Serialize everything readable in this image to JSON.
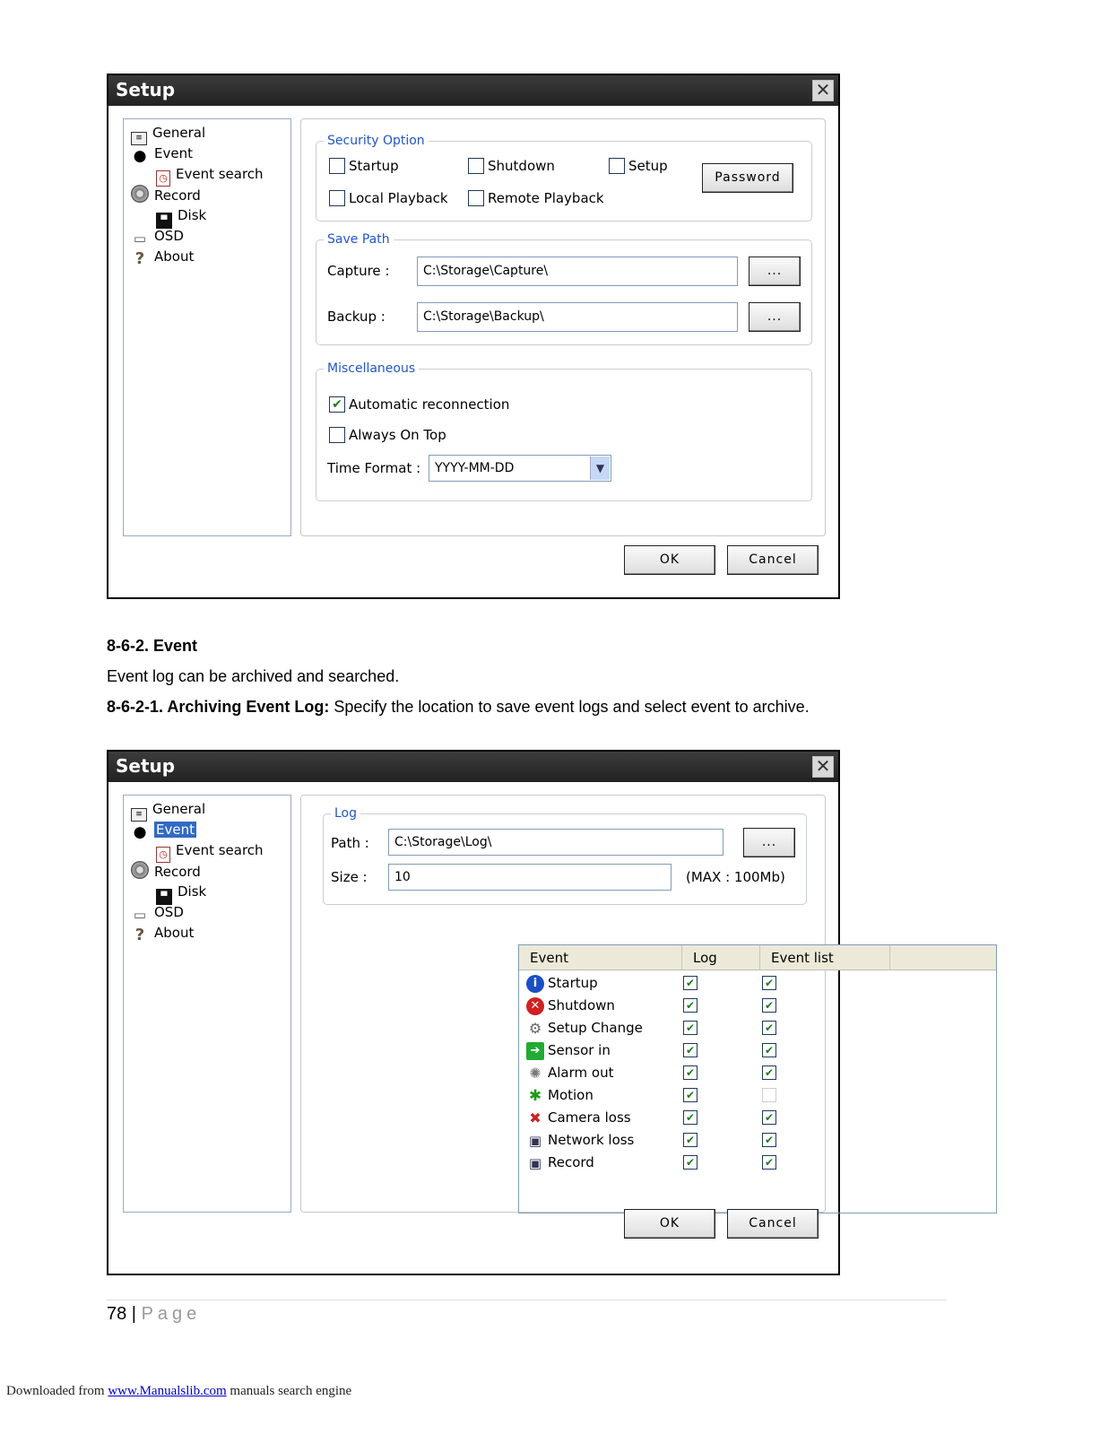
{
  "dialog1": {
    "title": "Setup",
    "close": "✕",
    "tree": [
      "General",
      "Event",
      "Event search",
      "Record",
      "Disk",
      "OSD",
      "About"
    ],
    "security": {
      "legend": "Security Option",
      "options": [
        "Startup",
        "Shutdown",
        "Setup",
        "Local Playback",
        "Remote Playback"
      ],
      "checked": [
        false,
        false,
        false,
        false,
        false
      ],
      "password_label": "Password"
    },
    "save_path": {
      "legend": "Save Path",
      "capture_label": "Capture :",
      "capture_value": "C:\\Storage\\Capture\\",
      "backup_label": "Backup :",
      "backup_value": "C:\\Storage\\Backup\\",
      "browse_label": "..."
    },
    "misc": {
      "legend": "Miscellaneous",
      "auto_reconnect": "Automatic reconnection",
      "auto_reconnect_checked": true,
      "always_on_top": "Always On Top",
      "always_on_top_checked": false,
      "time_format_label": "Time Format :",
      "time_format_value": "YYYY-MM-DD"
    },
    "ok": "OK",
    "cancel": "Cancel"
  },
  "section": {
    "heading": "8-6-2. Event",
    "intro": "Event log can be archived and searched.",
    "sub_bold": "8-6-2-1. Archiving Event Log:",
    "sub_text": " Specify the location to save event logs and select event to archive."
  },
  "dialog2": {
    "title": "Setup",
    "close": "✕",
    "tree": [
      "General",
      "Event",
      "Event search",
      "Record",
      "Disk",
      "OSD",
      "About"
    ],
    "selected_tree_item": "Event",
    "log": {
      "legend": "Log",
      "path_label": "Path :",
      "path_value": "C:\\Storage\\Log\\",
      "size_label": "Size :",
      "size_value": "10",
      "max_label": "(MAX : 100Mb)",
      "browse_label": "..."
    },
    "table": {
      "headers": [
        "Event",
        "Log",
        "Event list"
      ],
      "rows": [
        {
          "name": "Startup",
          "log": true,
          "list": true
        },
        {
          "name": "Shutdown",
          "log": true,
          "list": true
        },
        {
          "name": "Setup Change",
          "log": true,
          "list": true
        },
        {
          "name": "Sensor in",
          "log": true,
          "list": true
        },
        {
          "name": "Alarm out",
          "log": true,
          "list": true
        },
        {
          "name": "Motion",
          "log": true,
          "list": false
        },
        {
          "name": "Camera loss",
          "log": true,
          "list": true
        },
        {
          "name": "Network loss",
          "log": true,
          "list": true
        },
        {
          "name": "Record",
          "log": true,
          "list": true
        }
      ]
    },
    "ok": "OK",
    "cancel": "Cancel"
  },
  "footer": {
    "page_number": "78",
    "separator": " | ",
    "page_word": "Page",
    "download_prefix": "Downloaded from ",
    "download_link": "www.Manualslib.com",
    "download_suffix": " manuals search engine"
  },
  "colors": {
    "legend": "#2255cc",
    "selection": "#316ac5",
    "check": "#1e7a1e"
  }
}
